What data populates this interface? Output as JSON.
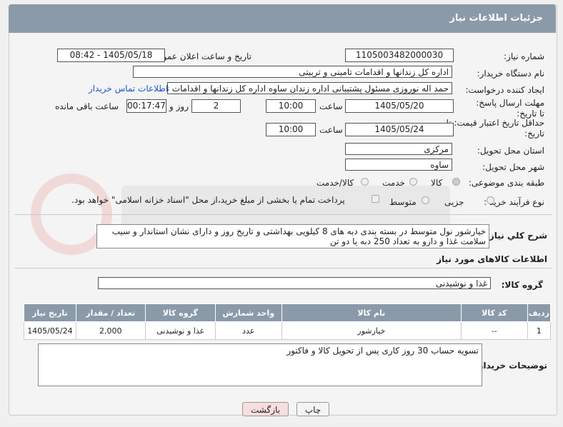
{
  "header": {
    "title": "جزئیات اطلاعات نیاز"
  },
  "fields": {
    "need_number_label": "شماره نیاز:",
    "need_number": "1105003482000030",
    "announce_label": "تاریخ و ساعت اعلان عمومی:",
    "announce_value": "1405/05/18 - 08:42",
    "buyer_org_label": "نام دستگاه خریدار:",
    "buyer_org": "اداره کل زندانها و اقدامات تامینی و تربیتی",
    "creator_label": "ایجاد کننده درخواست:",
    "creator": "حمد اله نوروزی مسئول پشتیبانی اداره زندان ساوه اداره کل زندانها و اقدامات تام",
    "buyer_contact_link": "اطلاعات تماس خریدار",
    "reply_deadline_label": "مهلت ارسال پاسخ: تا تاریخ:",
    "reply_date": "1405/05/20",
    "time_label": "ساعت",
    "reply_time": "10:00",
    "days_value": "2",
    "days_label": "روز و",
    "remaining_time": "00:17:47",
    "remaining_label": "ساعت باقی مانده",
    "price_validity_label": "حداقل تاریخ اعتبار قیمت: تا تاریخ:",
    "price_date": "1405/05/24",
    "price_time": "10:00",
    "province_label": "استان محل تحویل:",
    "province": "مرکزی",
    "city_label": "شهر محل تحویل:",
    "city": "ساوه",
    "category_label": "طبقه بندی موضوعی:",
    "category_options": [
      "کالا",
      "خدمت",
      "کالا/خدمت"
    ],
    "process_label": "نوع فرآیند خرید :",
    "process_options": [
      "جزیی",
      "متوسط"
    ],
    "payment_note": "پرداخت تمام یا بخشی از مبلغ خرید،از محل \"اسناد خزانه اسلامی\" خواهد بود."
  },
  "description": {
    "label": "شرح کلي نياز:",
    "text": "خیارشور نول متوسط در بسته بندی دبه های 8 کیلویی بهداشتی و تاریخ روز و دارای نشان استاندار و سیب سلامت غذا و دارو به تعداد 250 دبه یا دو تن"
  },
  "goods_info_title": "اطلاعات کالاهای مورد نیاز",
  "goods_group": {
    "label": "گروه کالا:",
    "value": "غذا و نوشیدنی"
  },
  "table": {
    "headers": [
      "ردیف",
      "کد کالا",
      "نام کالا",
      "واحد شمارش",
      "گروه کالا",
      "تعداد / مقدار",
      "تاریخ نیاز"
    ],
    "rows": [
      [
        "1",
        "--",
        "خیارشور",
        "عدد",
        "غذا و نوشیدنی",
        "2,000",
        "1405/05/24"
      ]
    ]
  },
  "buyer_notes": {
    "label": "توضیحات خریدار:",
    "text": "تسویه حساب 30 روز کاری پس از تحویل کالا و فاکتور"
  },
  "buttons": {
    "print": "چاپ",
    "back": "بازگشت"
  },
  "colors": {
    "header": "#8b9aa8",
    "back_button": "#f8dede",
    "link": "#2255cc"
  }
}
